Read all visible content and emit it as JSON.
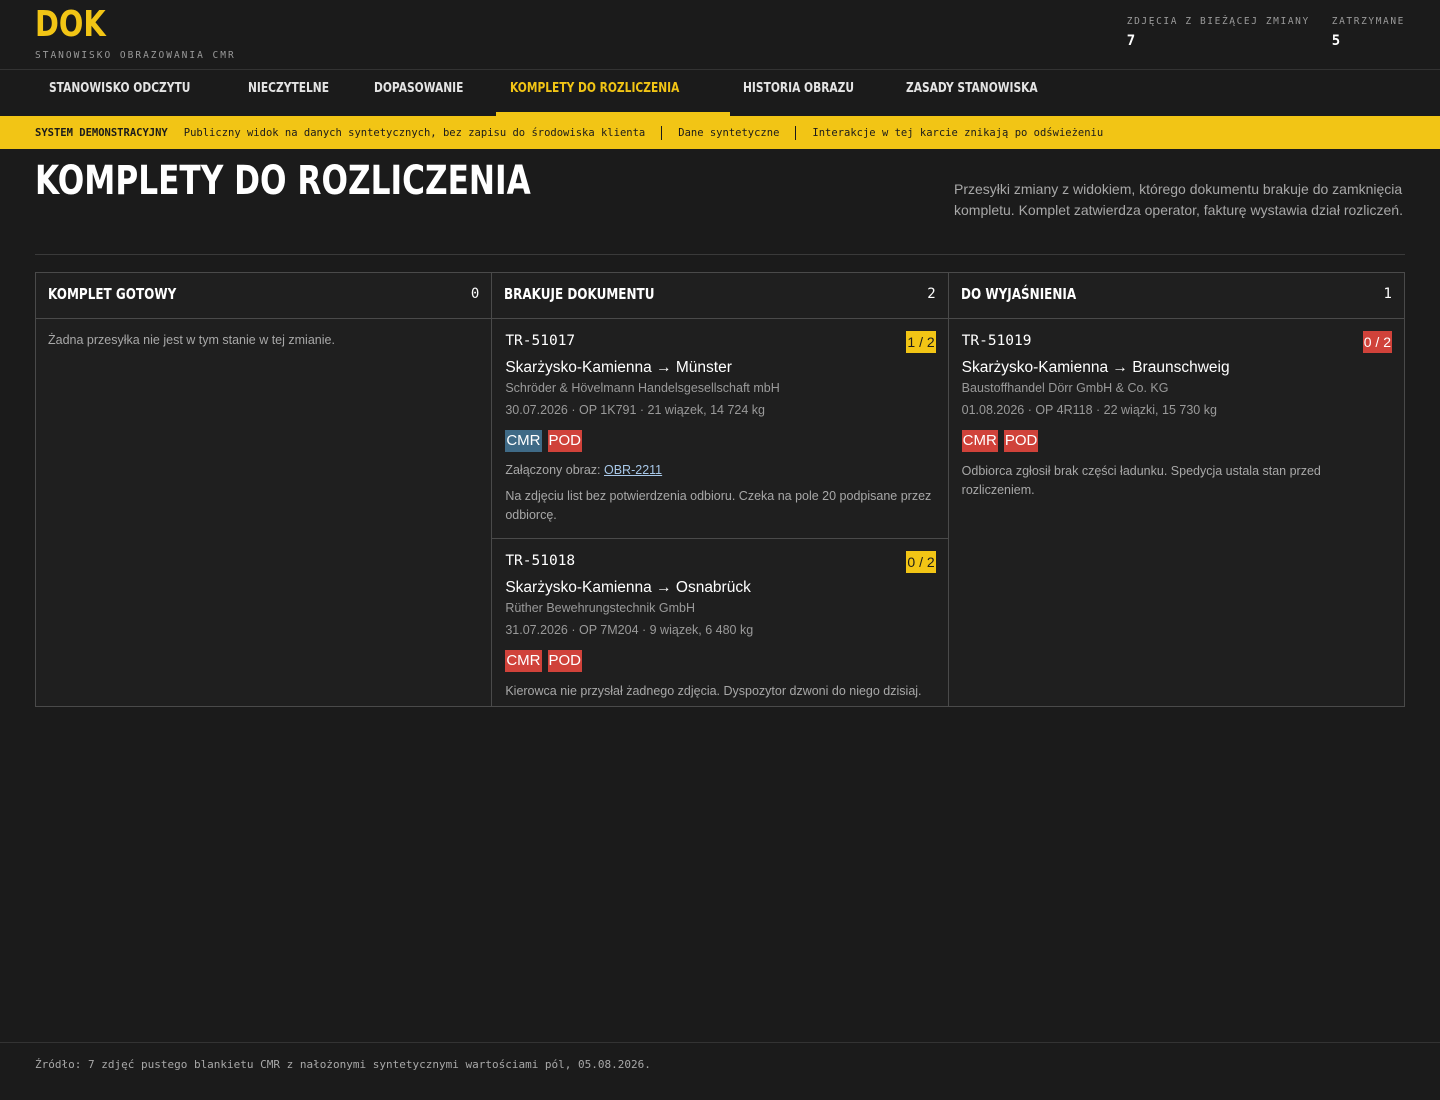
{
  "app": {
    "logo": "DOK",
    "subtitle": "STANOWISKO OBRAZOWANIA CMR"
  },
  "stats": [
    {
      "label": "ZDJĘCIA Z BIEŻĄCEJ ZMIANY",
      "value": "7"
    },
    {
      "label": "ZATRZYMANE",
      "value": "5"
    }
  ],
  "nav": {
    "tabs": [
      {
        "label": "STANOWISKO ODCZYTU"
      },
      {
        "label": "NIECZYTELNE"
      },
      {
        "label": "DOPASOWANIE"
      },
      {
        "label": "KOMPLETY DO ROZLICZENIA",
        "active": true
      },
      {
        "label": "HISTORIA OBRAZU"
      },
      {
        "label": "ZASADY STANOWISKA"
      }
    ]
  },
  "banner": {
    "label": "SYSTEM DEMONSTRACYJNY",
    "items": [
      "Publiczny widok na danych syntetycznych, bez zapisu do środowiska klienta",
      "Dane syntetyczne",
      "Interakcje w tej karcie znikają po odświeżeniu"
    ]
  },
  "page": {
    "title": "KOMPLETY DO ROZLICZENIA",
    "description": "Przesyłki zmiany z widokiem, którego dokumentu brakuje do zamknięcia kompletu. Komplet zatwierdza operator, fakturę wystawia dział rozliczeń."
  },
  "columns": [
    {
      "title": "KOMPLET GOTOWY",
      "count": "0",
      "empty": "Żadna przesyłka nie jest w tym stanie w tej zmianie.",
      "cards": []
    },
    {
      "title": "BRAKUJE DOKUMENTU",
      "count": "2",
      "empty": "",
      "cards": [
        {
          "id": "TR-51017",
          "ratio": "1 / 2",
          "ratio_color": "#f2c515",
          "route": "Skarżysko-Kamienna → Münster",
          "company": "Schröder & Hövelmann Handelsgesellschaft mbH",
          "meta": "30.07.2026 · OP 1K791 · 21 wiązek, 14 724 kg",
          "tags": [
            {
              "label": "CMR",
              "color": "#3f6a86"
            },
            {
              "label": "POD",
              "color": "#d0423a"
            }
          ],
          "attach_label": "Załączony obraz:",
          "attach_link": "OBR-2211",
          "note": "Na zdjęciu list bez potwierdzenia odbioru. Czeka na pole 20 podpisane przez odbiorcę."
        },
        {
          "id": "TR-51018",
          "ratio": "0 / 2",
          "ratio_color": "#f2c515",
          "route": "Skarżysko-Kamienna → Osnabrück",
          "company": "Rüther Bewehrungstechnik GmbH",
          "meta": "31.07.2026 · OP 7M204 · 9 wiązek, 6 480 kg",
          "tags": [
            {
              "label": "CMR",
              "color": "#d0423a"
            },
            {
              "label": "POD",
              "color": "#d0423a"
            }
          ],
          "attach_label": "",
          "attach_link": "",
          "note": "Kierowca nie przysłał żadnego zdjęcia. Dyspozytor dzwoni do niego dzisiaj."
        }
      ]
    },
    {
      "title": "DO WYJAŚNIENIA",
      "count": "1",
      "empty": "",
      "cards": [
        {
          "id": "TR-51019",
          "ratio": "0 / 2",
          "ratio_color": "#d0423a",
          "route": "Skarżysko-Kamienna → Braunschweig",
          "company": "Baustoffhandel Dörr GmbH & Co. KG",
          "meta": "01.08.2026 · OP 4R118 · 22 wiązki, 15 730 kg",
          "tags": [
            {
              "label": "CMR",
              "color": "#d0423a"
            },
            {
              "label": "POD",
              "color": "#d0423a"
            }
          ],
          "attach_label": "",
          "attach_link": "",
          "note": "Odbiorca zgłosił brak części ładunku. Spedycja ustala stan przed rozliczeniem."
        }
      ]
    }
  ],
  "footer": {
    "text": "Źródło: 7 zdjęć pustego blankietu CMR z nałożonymi syntetycznymi wartościami pól, 05.08.2026."
  }
}
